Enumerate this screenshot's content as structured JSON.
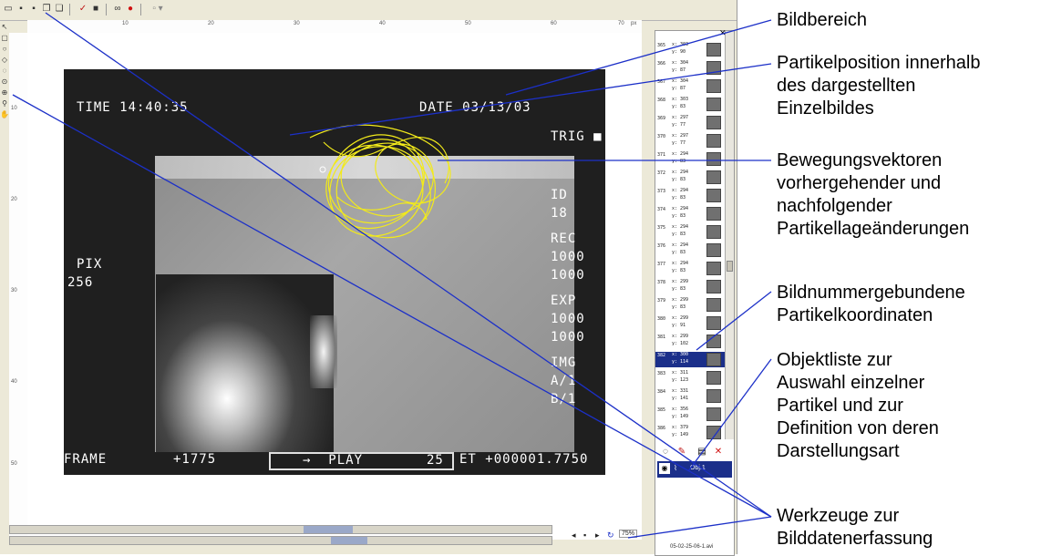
{
  "toolbar": {
    "icons": [
      "open-icon",
      "save-icon",
      "save-as-icon",
      "copy-icon",
      "paste-icon",
      "check-icon",
      "stop-icon",
      "binoculars-icon",
      "record-icon",
      "dropdown-icon"
    ]
  },
  "ruler": {
    "top_ticks": [
      "10",
      "20",
      "30",
      "40",
      "50",
      "60",
      "70",
      "px"
    ],
    "left_ticks": [
      "10",
      "20",
      "30",
      "40",
      "50"
    ]
  },
  "image": {
    "time": "TIME 14:40:35",
    "date": "DATE 03/13/03",
    "trig": "TRIG ■",
    "id_label": "ID",
    "id_value": "18",
    "rec_label": "REC",
    "rec_v1": "1000",
    "rec_v2": "1000",
    "exp_label": "EXP",
    "exp_v1": "1000",
    "exp_v2": "1000",
    "img_label": "IMG",
    "img_a": "A/1",
    "img_b": "B/1",
    "pix_label": "PIX",
    "pix_value": "256",
    "frame_label": "FRAME",
    "frame_value": "+1775",
    "play": "→  PLAY",
    "play_rate": "25",
    "et": "ET +000001.7750"
  },
  "object_list": {
    "rows": [
      {
        "num": "365",
        "x": "x: 303",
        "y": "y: 90"
      },
      {
        "num": "366",
        "x": "x: 304",
        "y": "y: 87"
      },
      {
        "num": "367",
        "x": "x: 304",
        "y": "y: 87"
      },
      {
        "num": "368",
        "x": "x: 303",
        "y": "y: 83"
      },
      {
        "num": "369",
        "x": "x: 297",
        "y": "y: 77"
      },
      {
        "num": "370",
        "x": "x: 297",
        "y": "y: 77"
      },
      {
        "num": "371",
        "x": "x: 294",
        "y": "y: 83"
      },
      {
        "num": "372",
        "x": "x: 294",
        "y": "y: 83"
      },
      {
        "num": "373",
        "x": "x: 294",
        "y": "y: 83"
      },
      {
        "num": "374",
        "x": "x: 294",
        "y": "y: 83"
      },
      {
        "num": "375",
        "x": "x: 294",
        "y": "y: 83"
      },
      {
        "num": "376",
        "x": "x: 294",
        "y": "y: 83"
      },
      {
        "num": "377",
        "x": "x: 294",
        "y": "y: 83"
      },
      {
        "num": "378",
        "x": "x: 299",
        "y": "y: 83"
      },
      {
        "num": "379",
        "x": "x: 299",
        "y": "y: 83"
      },
      {
        "num": "380",
        "x": "x: 299",
        "y": "y: 91"
      },
      {
        "num": "381",
        "x": "x: 299",
        "y": "y: 102"
      },
      {
        "num": "382",
        "x": "x: 300",
        "y": "y: 114"
      },
      {
        "num": "383",
        "x": "x: 311",
        "y": "y: 123"
      },
      {
        "num": "384",
        "x": "x: 331",
        "y": "y: 141"
      },
      {
        "num": "385",
        "x": "x: 356",
        "y": "y: 149"
      },
      {
        "num": "386",
        "x": "x: 379",
        "y": "y: 149"
      }
    ],
    "selected_index": 17,
    "layer_name": "Obj.1",
    "filename": "05-02-25-06-1.avi"
  },
  "status": {
    "zoom": "75%"
  },
  "annotations": [
    {
      "lines": [
        "Bildbereich"
      ]
    },
    {
      "lines": [
        "Partikelposition innerhalb",
        "des dargestellten",
        "Einzelbildes"
      ]
    },
    {
      "lines": [
        "Bewegungsvektoren",
        "vorhergehender und",
        "nachfolgender",
        "Partikellageänderungen"
      ]
    },
    {
      "lines": [
        "Bildnummergebundene",
        "Partikelkoordinaten"
      ]
    },
    {
      "lines": [
        "Objektliste zur",
        "Auswahl einzelner",
        "Partikel und zur",
        "Definition von deren",
        "Darstellungsart"
      ]
    },
    {
      "lines": [
        "Werkzeuge zur",
        "Bilddatenerfassung"
      ]
    }
  ],
  "colors": {
    "trajectory": "#f2ea1a",
    "leader": "#1c30c8",
    "selection": "#1b2f8a"
  }
}
